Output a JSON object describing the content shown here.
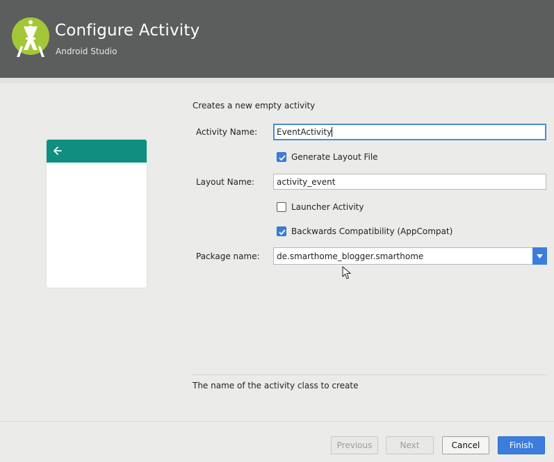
{
  "header": {
    "title": "Configure Activity",
    "subtitle": "Android Studio",
    "logo_icon": "android-studio-logo"
  },
  "preview": {
    "back_icon": "arrow-left-icon",
    "bar_color": "#0f8f7f"
  },
  "form": {
    "description": "Creates a new empty activity",
    "activity_name": {
      "label": "Activity Name:",
      "value": "EventActivity"
    },
    "generate_layout": {
      "label": "Generate Layout File",
      "checked": true
    },
    "layout_name": {
      "label": "Layout Name:",
      "value": "activity_event"
    },
    "launcher_activity": {
      "label": "Launcher Activity",
      "checked": false
    },
    "backwards_compat": {
      "label": "Backwards Compatibility (AppCompat)",
      "checked": true
    },
    "package_name": {
      "label": "Package name:",
      "value": "de.smarthome_blogger.smarthome"
    }
  },
  "hint": "The name of the activity class to create",
  "buttons": {
    "previous": "Previous",
    "next": "Next",
    "cancel": "Cancel",
    "finish": "Finish"
  },
  "colors": {
    "accent": "#3b7ddd",
    "header_bg": "#5b5e5d",
    "logo_green": "#a4c639"
  }
}
